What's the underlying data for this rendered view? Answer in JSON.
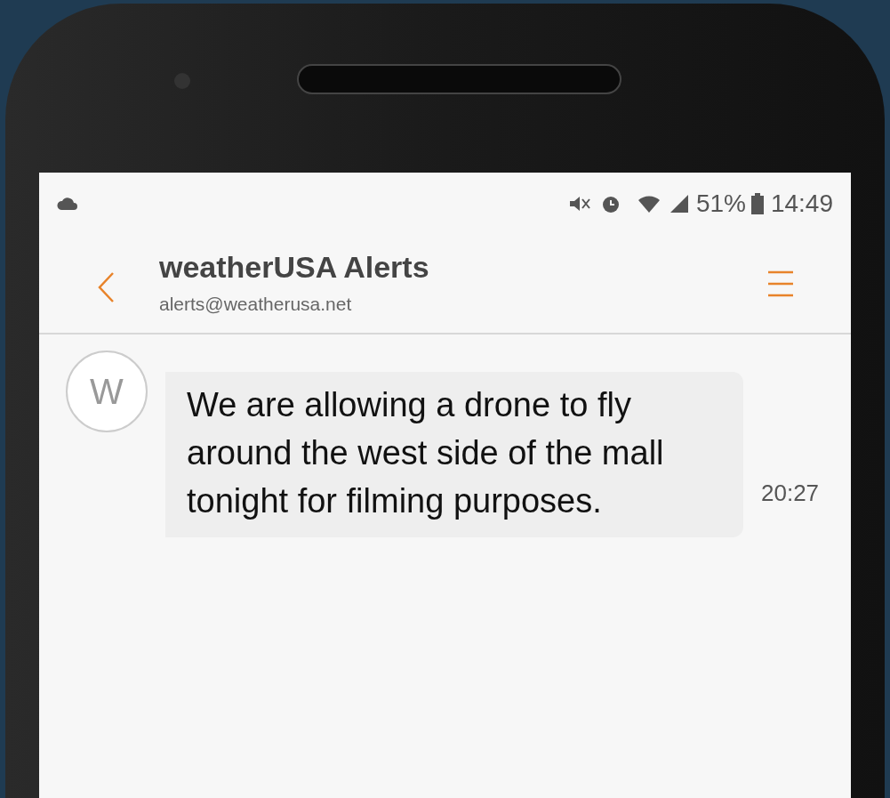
{
  "status_bar": {
    "battery": "51%",
    "time": "14:49"
  },
  "header": {
    "title": "weatherUSA Alerts",
    "subtitle": "alerts@weatherusa.net"
  },
  "message": {
    "avatar": "W",
    "text": "We are allowing a drone to fly around the west side of the mall tonight for filming purposes.",
    "time": "20:27"
  }
}
